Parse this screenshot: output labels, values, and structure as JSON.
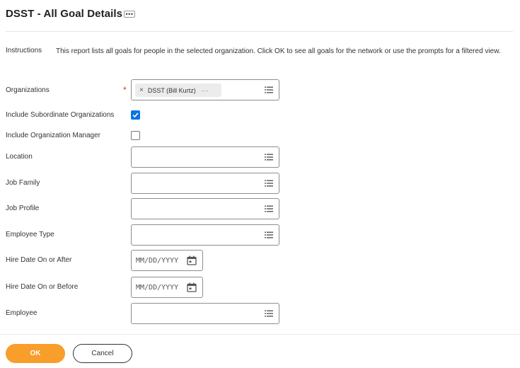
{
  "page": {
    "title": "DSST - All Goal Details",
    "related_actions_icon": "ellipsis-icon"
  },
  "instructions": {
    "label": "Instructions",
    "text": "This report lists all goals for people in the selected organization. Click OK to see all goals for the network or use the prompts for a filtered view."
  },
  "fields": {
    "organizations": {
      "label": "Organizations",
      "required_mark": "*",
      "selected_value": "DSST (Bill Kurtz)",
      "remove_glyph": "×",
      "more_glyph": "···"
    },
    "include_subordinate": {
      "label": "Include Subordinate Organizations",
      "checked": true
    },
    "include_manager": {
      "label": "Include Organization Manager",
      "checked": false
    },
    "location": {
      "label": "Location",
      "value": ""
    },
    "job_family": {
      "label": "Job Family",
      "value": ""
    },
    "job_profile": {
      "label": "Job Profile",
      "value": ""
    },
    "employee_type": {
      "label": "Employee Type",
      "value": ""
    },
    "hire_date_after": {
      "label": "Hire Date On or After",
      "placeholder": "MM/DD/YYYY"
    },
    "hire_date_before": {
      "label": "Hire Date On or Before",
      "placeholder": "MM/DD/YYYY"
    },
    "employee": {
      "label": "Employee",
      "value": ""
    }
  },
  "buttons": {
    "ok": "OK",
    "cancel": "Cancel"
  },
  "colors": {
    "primary_button": "#f99d2b",
    "checkbox_checked": "#0875e1",
    "required": "#de2e21"
  }
}
